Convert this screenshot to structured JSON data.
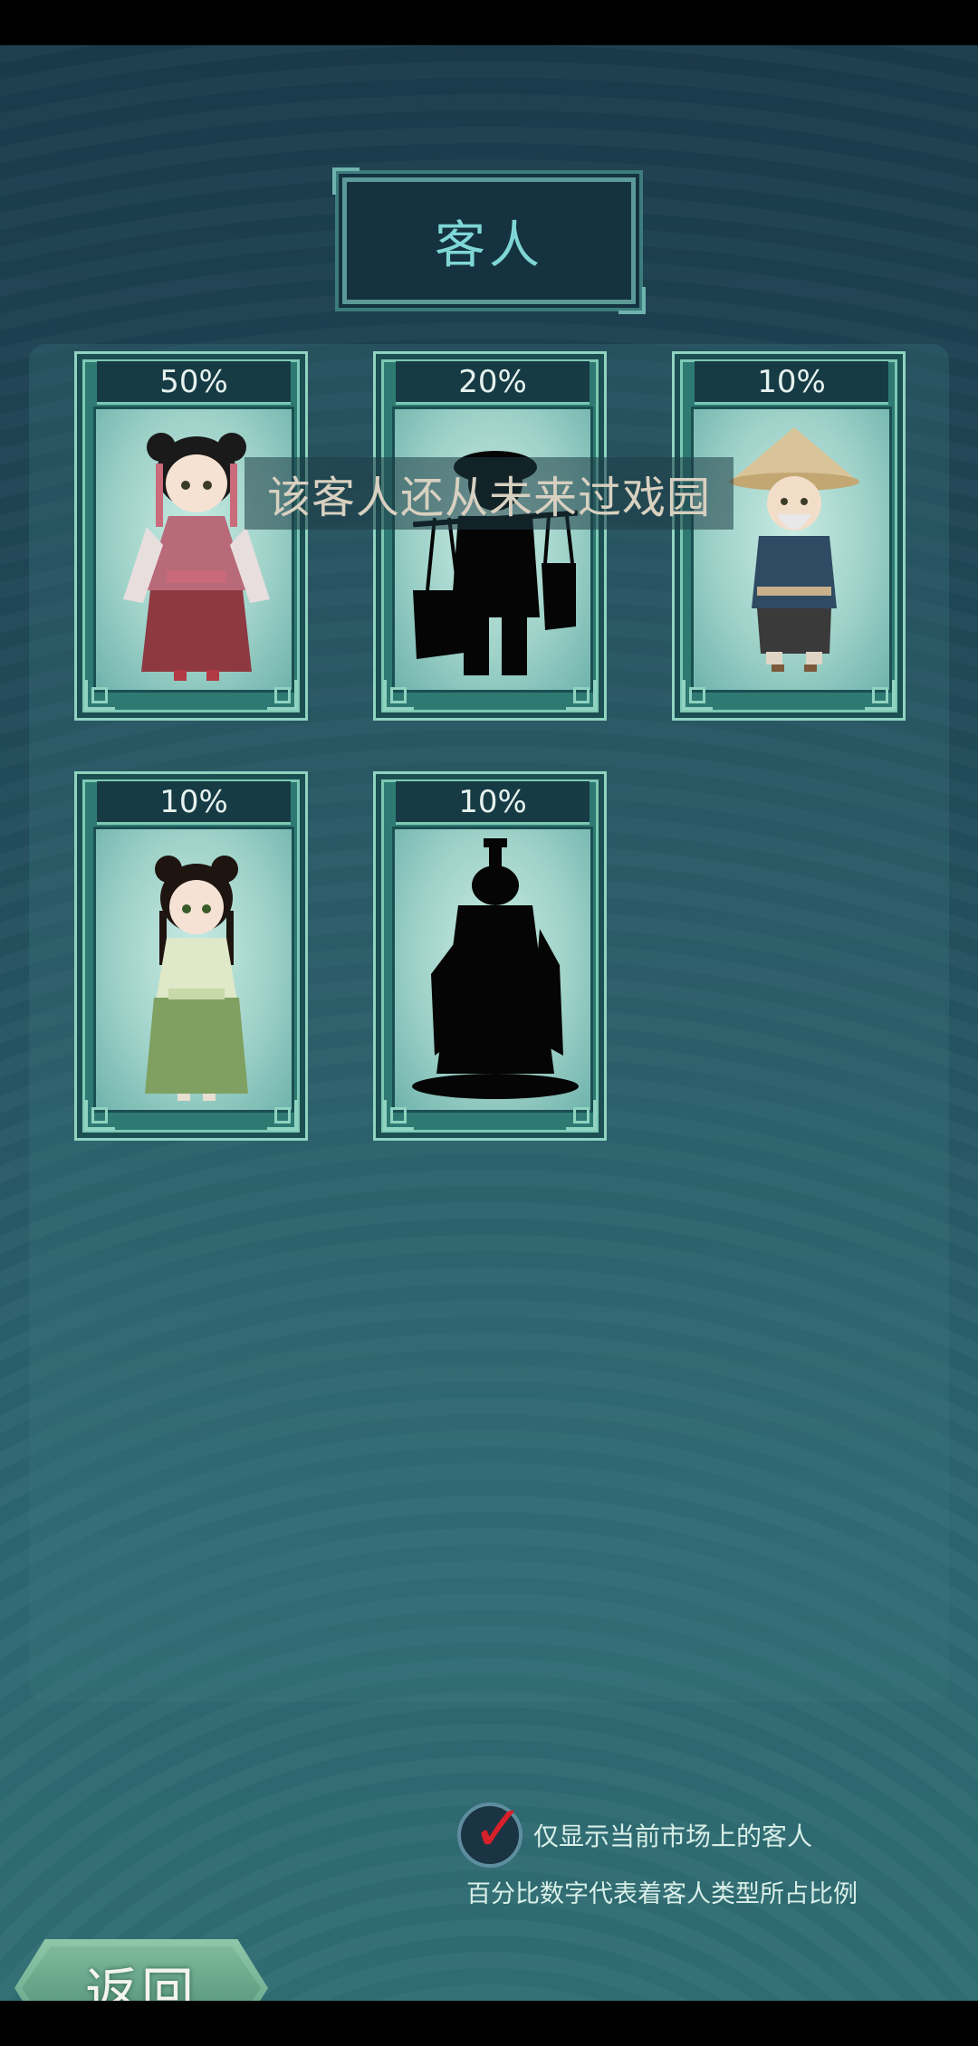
{
  "title": "客人",
  "hint": "该客人还从未来过戏园",
  "guests": [
    {
      "percent": "50%",
      "known": true,
      "name": "girl-red-dress"
    },
    {
      "percent": "20%",
      "known": false,
      "name": "porter-silhouette"
    },
    {
      "percent": "10%",
      "known": true,
      "name": "old-farmer"
    },
    {
      "percent": "10%",
      "known": true,
      "name": "girl-green-dress"
    },
    {
      "percent": "10%",
      "known": false,
      "name": "official-silhouette"
    }
  ],
  "filter": {
    "checked": true,
    "label": "仅显示当前市场上的客人"
  },
  "note": "百分比数字代表着客人类型所占比例",
  "back_label": "返回",
  "colors": {
    "accent_teal": "#7fd6d6",
    "check_red": "#d6202a"
  }
}
